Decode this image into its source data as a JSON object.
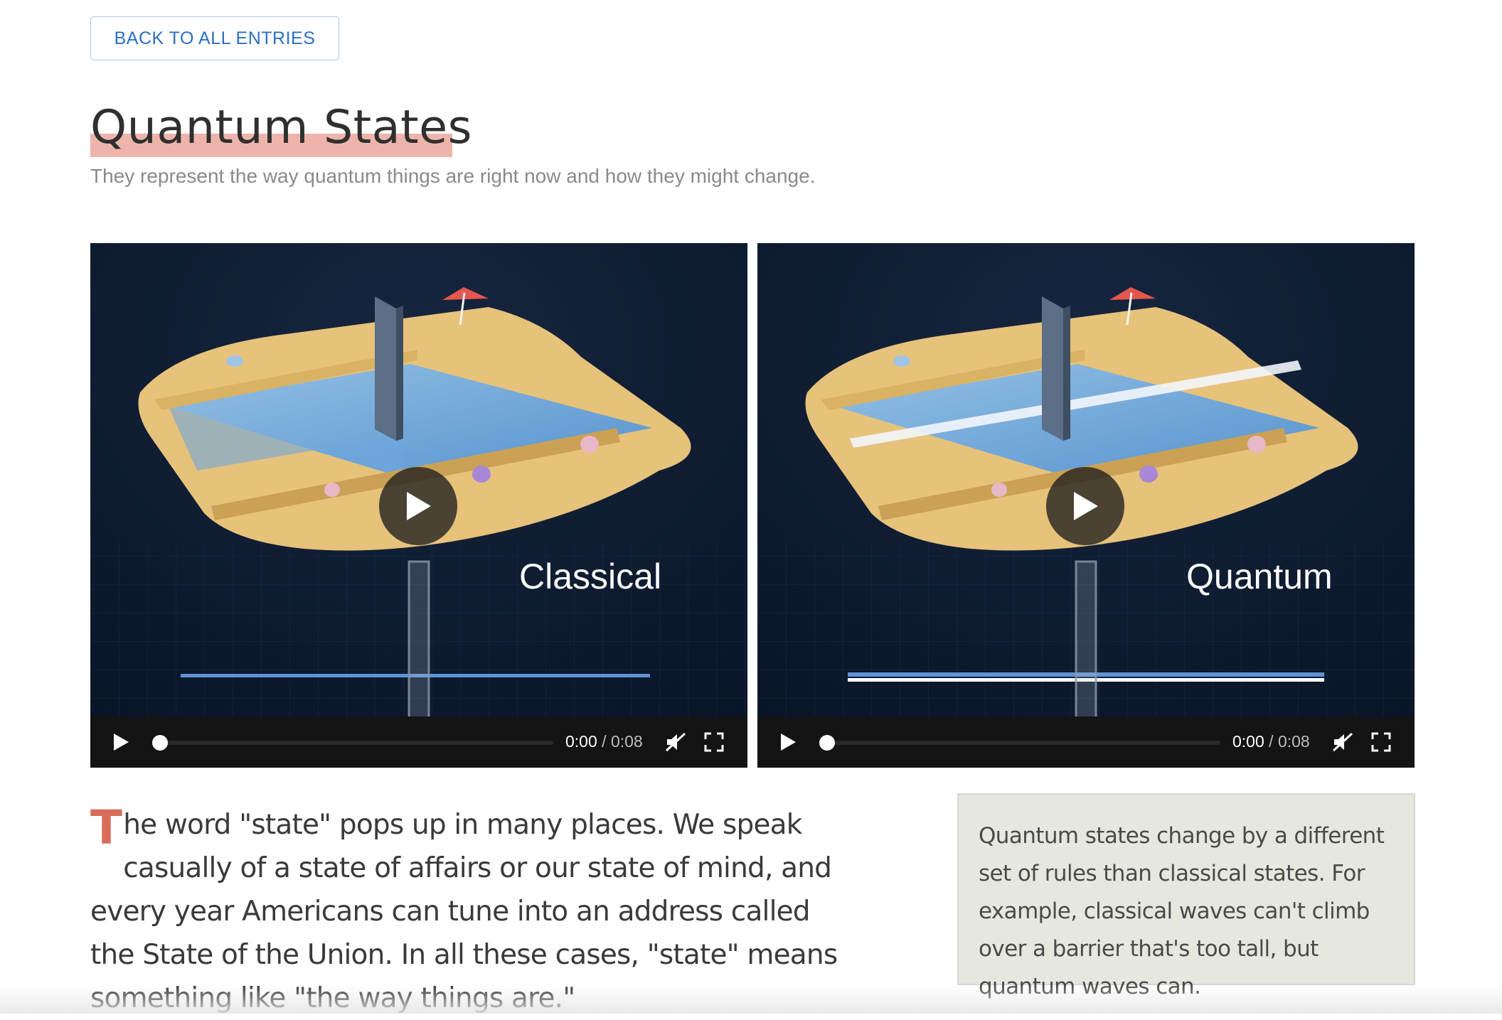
{
  "nav": {
    "back_label": "BACK TO ALL ENTRIES"
  },
  "header": {
    "title": "Quantum States",
    "subtitle": "They represent the way quantum things are right now and how they might change."
  },
  "videos": [
    {
      "label": "Classical",
      "current_time": "0:00",
      "separator": " / ",
      "duration": "0:08",
      "progress": 0
    },
    {
      "label": "Quantum",
      "current_time": "0:00",
      "separator": " / ",
      "duration": "0:08",
      "progress": 0
    }
  ],
  "article": {
    "dropcap": "T",
    "paragraph": "he word \"state\" pops up in many places. We speak casually of a state of affairs or our state of mind, and every year Americans can tune into an address called the State of the Union. In all these cases, \"state\" means something like \"the way things are.\""
  },
  "callout": {
    "text": "Quantum states change by a different set of rules than classical states. For example, classical waves can't climb over a barrier that's too tall, but quantum waves can."
  },
  "colors": {
    "link_blue": "#2d6fc4",
    "title_highlight": "#eeb4ab",
    "dropcap": "#d86c5a",
    "callout_bg": "#e6e8e0",
    "video_bg": "#0d1a2e"
  }
}
